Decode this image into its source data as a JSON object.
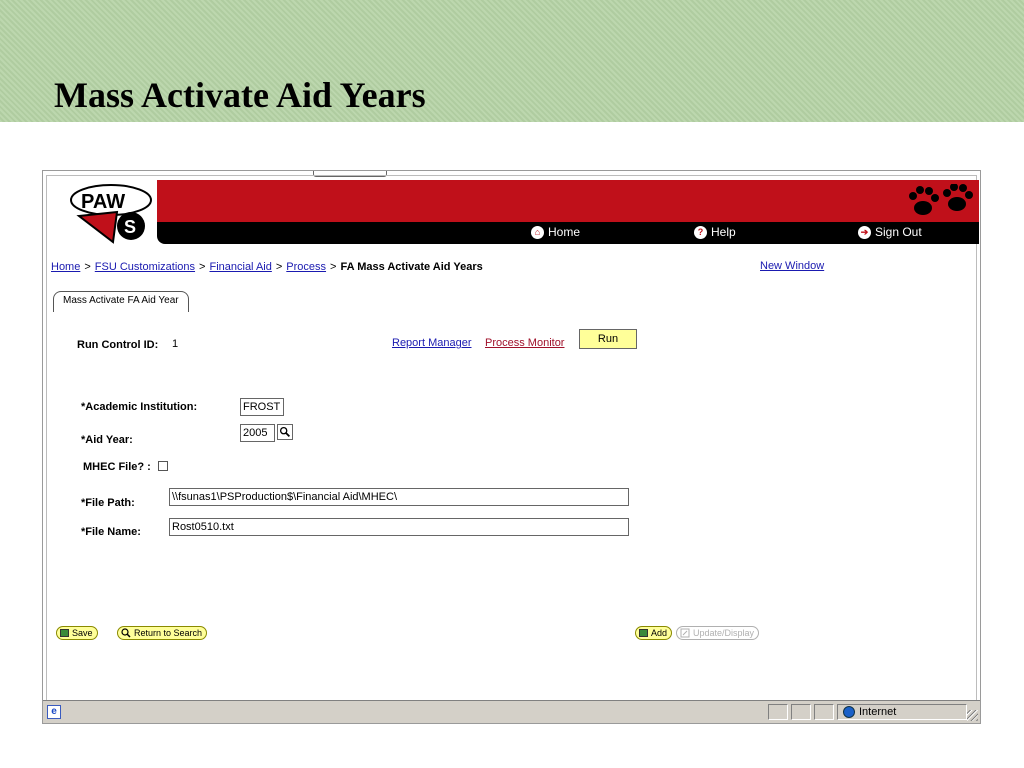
{
  "slide": {
    "title": "Mass Activate Aid Years"
  },
  "banner": {
    "logo_text": "PAWS",
    "nav": {
      "home": "Home",
      "help": "Help",
      "sign_out": "Sign Out"
    }
  },
  "breadcrumb": {
    "home": "Home",
    "fsu": "FSU Customizations",
    "financial_aid": "Financial Aid",
    "process": "Process",
    "current": "FA Mass Activate Aid Years",
    "separator": ">"
  },
  "new_window": "New Window",
  "tab": {
    "label": "Mass Activate FA Aid Year"
  },
  "run_control": {
    "label": "Run Control ID:",
    "value": "1"
  },
  "links": {
    "report_manager": "Report Manager",
    "process_monitor": "Process Monitor",
    "run": "Run"
  },
  "form": {
    "academic_institution": {
      "label": "*Academic Institution:",
      "value": "FROST"
    },
    "aid_year": {
      "label": "*Aid Year:",
      "value": "2005"
    },
    "mhec_file": {
      "label": "MHEC File? :",
      "checked": false
    },
    "file_path": {
      "label": "*File Path:",
      "value": "\\\\fsunas1\\PSProduction$\\Financial Aid\\MHEC\\"
    },
    "file_name": {
      "label": "*File Name:",
      "value": "Rost0510.txt"
    }
  },
  "buttons": {
    "save": "Save",
    "return_to_search": "Return to Search",
    "add": "Add",
    "update_display": "Update/Display"
  },
  "statusbar": {
    "zone": "Internet"
  },
  "colors": {
    "header_green": "#b5d3a5",
    "banner_red": "#c0101a",
    "button_yellow": "#ffff99",
    "link_blue": "#1a1ab0"
  }
}
